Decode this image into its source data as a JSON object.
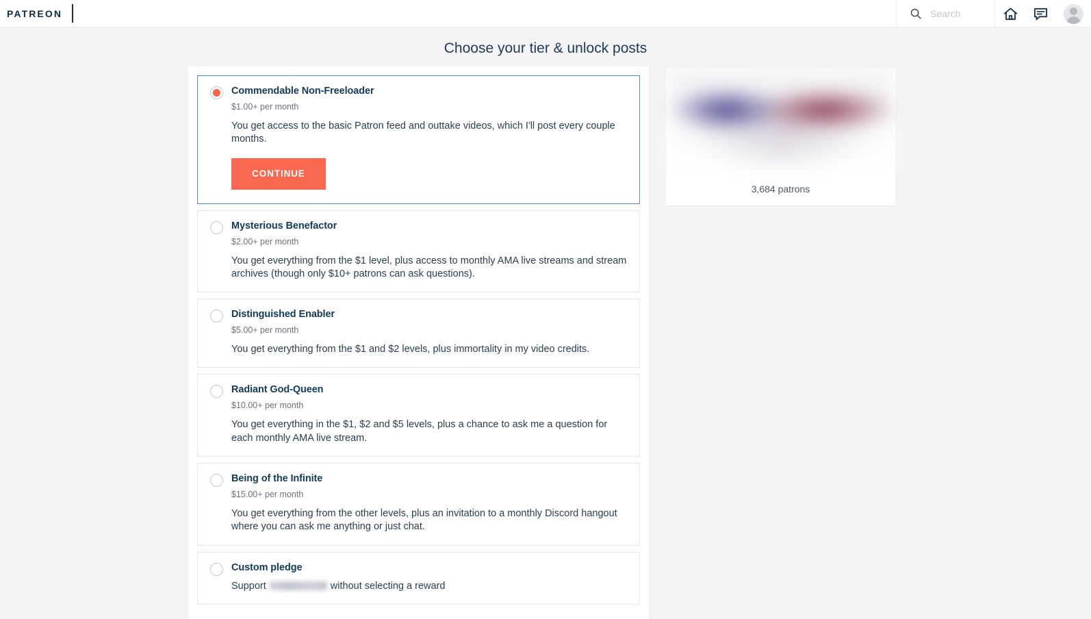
{
  "header": {
    "brand": "PATREON",
    "search": {
      "placeholder": "Search",
      "value": "",
      "icon": "search-icon"
    },
    "icons": [
      {
        "name": "home-icon",
        "label": "Home"
      },
      {
        "name": "messages-icon",
        "label": "Messages"
      },
      {
        "name": "avatar",
        "label": "Profile"
      }
    ]
  },
  "page": {
    "title": "Choose your tier & unlock posts"
  },
  "tiers": [
    {
      "title": "Commendable Non-Freeloader",
      "price": "$1.00+ per month",
      "description": "You get access to the basic Patron feed and outtake videos, which I'll post every couple months.",
      "selected": true,
      "cta": "CONTINUE"
    },
    {
      "title": "Mysterious Benefactor",
      "price": "$2.00+ per month",
      "description": "You get everything from the $1 level, plus access to monthly AMA live streams and stream archives (though only $10+ patrons can ask questions).",
      "selected": false
    },
    {
      "title": "Distinguished Enabler",
      "price": "$5.00+ per month",
      "description": "You get everything from the $1 and $2 levels, plus immortality in my video credits.",
      "selected": false
    },
    {
      "title": "Radiant God-Queen",
      "price": "$10.00+ per month",
      "description": "You get everything in the $1, $2 and $5 levels, plus a chance to ask me a question for each monthly AMA live stream.",
      "selected": false
    },
    {
      "title": "Being of the Infinite",
      "price": "$15.00+ per month",
      "description": "You get everything from the other levels, plus an invitation to a monthly Discord hangout where you can ask me anything or just chat.",
      "selected": false
    }
  ],
  "custom_pledge": {
    "title": "Custom pledge",
    "support_prefix": "Support",
    "creator_name_blurred": true,
    "support_suffix": "without selecting a reward",
    "selected": false
  },
  "sidebar": {
    "banner": "blurred-creator-banner",
    "patron_count": "3,684 patrons"
  },
  "colors": {
    "accent": "#f9684f",
    "selected_border": "#4a90c4",
    "title": "#123a5e",
    "page_bg": "#f4f4f7"
  }
}
